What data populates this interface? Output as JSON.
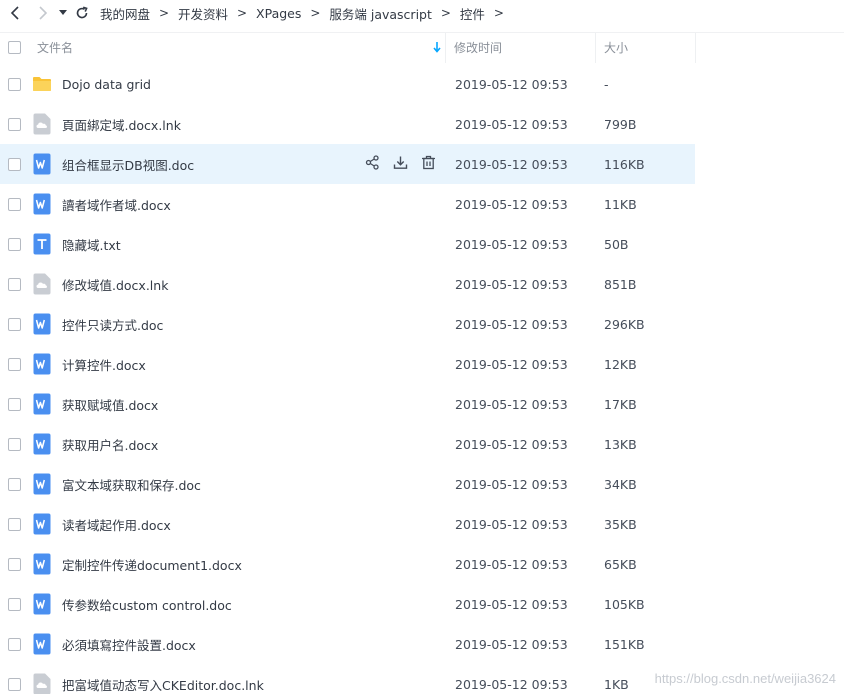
{
  "breadcrumbs": [
    "我的网盘",
    "开发资料",
    "XPages",
    "服务端 javascript",
    "控件"
  ],
  "header": {
    "name": "文件名",
    "time": "修改时间",
    "size": "大小"
  },
  "actions": [
    "share-icon",
    "download-icon",
    "delete-icon"
  ],
  "files": [
    {
      "name": "Dojo data grid",
      "type": "folder",
      "time": "2019-05-12 09:53",
      "size": "-"
    },
    {
      "name": "頁面綁定域.docx.lnk",
      "type": "link",
      "time": "2019-05-12 09:53",
      "size": "799B"
    },
    {
      "name": "组合框显示DB视图.doc",
      "type": "word",
      "time": "2019-05-12 09:53",
      "size": "116KB",
      "hover": true
    },
    {
      "name": "讀者域作者域.docx",
      "type": "word",
      "time": "2019-05-12 09:53",
      "size": "11KB"
    },
    {
      "name": "隐藏域.txt",
      "type": "text",
      "time": "2019-05-12 09:53",
      "size": "50B"
    },
    {
      "name": "修改域值.docx.lnk",
      "type": "link",
      "time": "2019-05-12 09:53",
      "size": "851B"
    },
    {
      "name": "控件只读方式.doc",
      "type": "word",
      "time": "2019-05-12 09:53",
      "size": "296KB"
    },
    {
      "name": "计算控件.docx",
      "type": "word",
      "time": "2019-05-12 09:53",
      "size": "12KB"
    },
    {
      "name": "获取赋域值.docx",
      "type": "word",
      "time": "2019-05-12 09:53",
      "size": "17KB"
    },
    {
      "name": "获取用户名.docx",
      "type": "word",
      "time": "2019-05-12 09:53",
      "size": "13KB"
    },
    {
      "name": "富文本域获取和保存.doc",
      "type": "word",
      "time": "2019-05-12 09:53",
      "size": "34KB"
    },
    {
      "name": "读者域起作用.docx",
      "type": "word",
      "time": "2019-05-12 09:53",
      "size": "35KB"
    },
    {
      "name": "定制控件传递document1.docx",
      "type": "word",
      "time": "2019-05-12 09:53",
      "size": "65KB"
    },
    {
      "name": "传参数给custom control.doc",
      "type": "word",
      "time": "2019-05-12 09:53",
      "size": "105KB"
    },
    {
      "name": "必須填寫控件設置.docx",
      "type": "word",
      "time": "2019-05-12 09:53",
      "size": "151KB"
    },
    {
      "name": "把富域值动态写入CKEditor.doc.lnk",
      "type": "link",
      "time": "2019-05-12 09:53",
      "size": "1KB"
    }
  ],
  "watermark": "https://blog.csdn.net/weijia3624",
  "colors": {
    "accent": "#06a7ff",
    "hover_row": "#e8f4fd",
    "folder": "#f9c337",
    "word": "#4a8ff0",
    "text": "#4a8ff0",
    "link": "#c9cdd3"
  }
}
